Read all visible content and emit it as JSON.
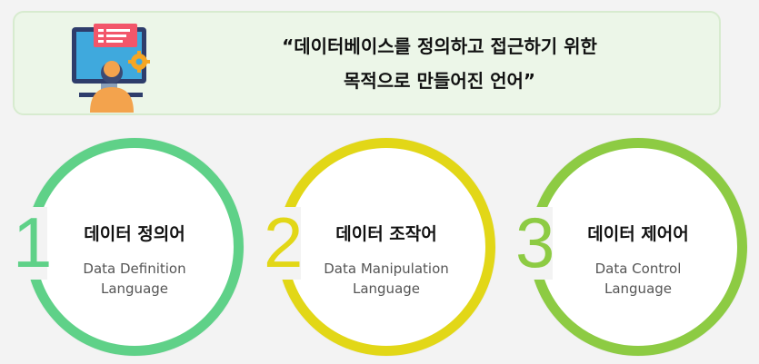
{
  "banner": {
    "quote_line1": "“데이터베이스를 정의하고 접근하기 위한",
    "quote_line2": "목적으로 만들어진 언어”",
    "illustration_icon": "developer-at-monitor-icon"
  },
  "items": [
    {
      "number": "1",
      "title": "데이터 정의어",
      "sub_line1": "Data Definition",
      "sub_line2": "Language",
      "color": "#5fd188"
    },
    {
      "number": "2",
      "title": "데이터 조작어",
      "sub_line1": "Data Manipulation",
      "sub_line2": "Language",
      "color": "#e2d717"
    },
    {
      "number": "3",
      "title": "데이터 제어어",
      "sub_line1": "Data Control",
      "sub_line2": "Language",
      "color": "#8dcb43"
    }
  ],
  "colors": {
    "background": "#f3f3f3",
    "banner_bg": "#ecf6e8"
  }
}
